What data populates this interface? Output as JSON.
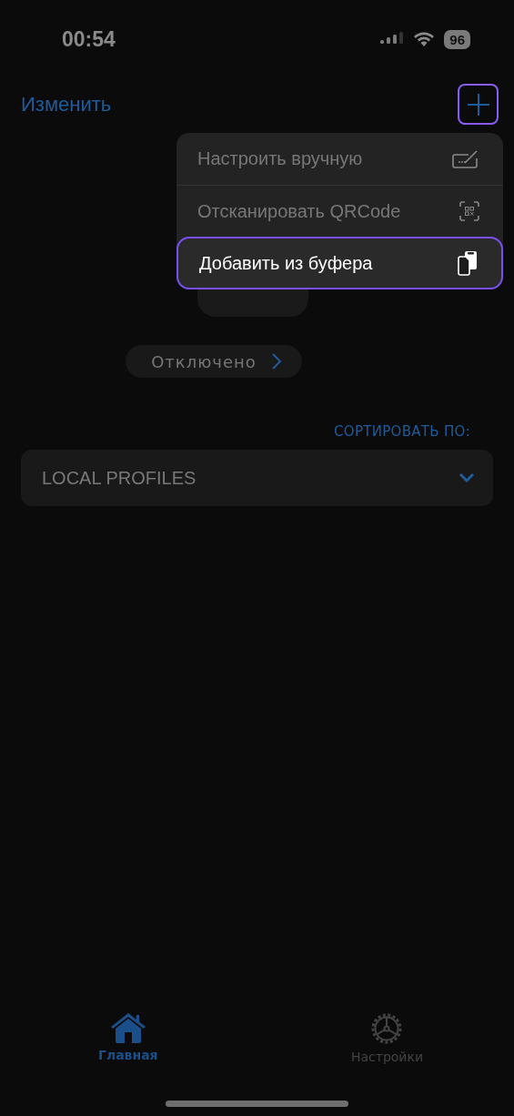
{
  "status_bar": {
    "time": "00:54",
    "battery": "96"
  },
  "nav": {
    "edit": "Изменить"
  },
  "add_menu": {
    "items": [
      {
        "label": "Настроить вручную",
        "kind": "manual",
        "selected": false
      },
      {
        "label": "Отсканировать QRCode",
        "kind": "qr",
        "selected": false
      },
      {
        "label": "Добавить из буфера",
        "kind": "clipboard",
        "selected": true
      }
    ]
  },
  "connection": {
    "status": "Отключено"
  },
  "sort": {
    "label": "СОРТИРОВАТЬ ПО:"
  },
  "profiles": {
    "label": "LOCAL PROFILES",
    "expanded": false
  },
  "tab_bar": {
    "tabs": [
      {
        "label": "Главная",
        "kind": "home",
        "selected": true
      },
      {
        "label": "Настройки",
        "kind": "settings",
        "selected": false
      }
    ]
  }
}
